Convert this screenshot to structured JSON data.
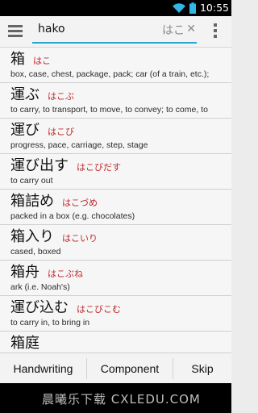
{
  "status_bar": {
    "time": "10:55",
    "wifi_icon": "wifi-icon",
    "battery_icon": "battery-icon"
  },
  "action_bar": {
    "menu_icon": "menu-icon",
    "search": {
      "value": "hako",
      "hint": "はこ",
      "clear_icon": "close-icon"
    },
    "overflow_icon": "overflow-menu-icon",
    "accent_color": "#2aa3d2"
  },
  "entries": [
    {
      "word": "箱",
      "reading": "はこ",
      "meaning": "box, case, chest, package, pack; car (of a train, etc.);"
    },
    {
      "word": "運ぶ",
      "reading": "はこぶ",
      "meaning": "to carry, to transport, to move, to convey; to come, to"
    },
    {
      "word": "運び",
      "reading": "はこび",
      "meaning": "progress, pace, carriage, step, stage"
    },
    {
      "word": "運び出す",
      "reading": "はこびだす",
      "meaning": "to carry out"
    },
    {
      "word": "箱詰め",
      "reading": "はこづめ",
      "meaning": "packed in a box (e.g. chocolates)"
    },
    {
      "word": "箱入り",
      "reading": "はこいり",
      "meaning": "cased, boxed"
    },
    {
      "word": "箱舟",
      "reading": "はこぶね",
      "meaning": "ark (i.e. Noah's)"
    },
    {
      "word": "運び込む",
      "reading": "はこびこむ",
      "meaning": "to carry in, to bring in"
    },
    {
      "word": "箱庭",
      "reading": "",
      "meaning": ""
    }
  ],
  "reading_color": "#c0262b",
  "bottom_bar": {
    "handwriting": "Handwriting",
    "component": "Component",
    "skip": "Skip"
  },
  "watermark": "晨曦乐下载 CXLEDU.COM"
}
